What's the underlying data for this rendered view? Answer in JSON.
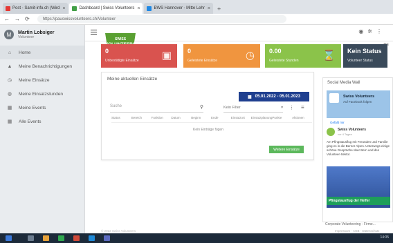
{
  "browser": {
    "tabs": [
      {
        "label": "Post - Samit-info.ch (Wird",
        "active": false
      },
      {
        "label": "Dashboard | Swiss Volunteers",
        "active": true
      },
      {
        "label": "BWS Hannover - Mitte Lehr",
        "active": false
      }
    ],
    "new_tab": "+",
    "nav": {
      "back": "←",
      "forward": "→",
      "reload": "⟳"
    },
    "url": "https://pauswissvolunteers.ch/Volunteer"
  },
  "sidebar": {
    "user": {
      "initial": "M",
      "name": "Martin Lobsiger",
      "role": "Volunteer"
    },
    "items": [
      {
        "label": "Home",
        "icon": "home-icon",
        "glyph": "⌂",
        "active": true
      },
      {
        "label": "Meine Benachrichtigungen",
        "icon": "bell-icon",
        "glyph": "🔔",
        "active": false
      },
      {
        "label": "Meine Einsätze",
        "icon": "clock-icon",
        "glyph": "◷",
        "active": false
      },
      {
        "label": "Meine Einsatzstunden",
        "icon": "gauge-icon",
        "glyph": "◍",
        "active": false
      },
      {
        "label": "Meine Events",
        "icon": "calendar-icon",
        "glyph": "▦",
        "active": false
      },
      {
        "label": "Alle Events",
        "icon": "calendar-icon",
        "glyph": "▦",
        "active": false
      }
    ]
  },
  "header": {
    "lang": "DE"
  },
  "logo": {
    "text1": "SWISS",
    "text2": "VOLUNTEERS"
  },
  "tiles": [
    {
      "value": "0",
      "label": "Unbestätigte Einsätze",
      "icon": "clipboard-icon",
      "glyph": "▣",
      "color": "#d9534f"
    },
    {
      "value": "0",
      "label": "Geleistete Einsätze",
      "icon": "clock-icon",
      "glyph": "◷",
      "color": "#f0953f"
    },
    {
      "value": "0.00",
      "label": "Geleistete Stunden",
      "icon": "hourglass-icon",
      "glyph": "⌛",
      "color": "#8bc34a"
    },
    {
      "value": "Kein Status",
      "label": "Volunteer Status",
      "icon": "",
      "glyph": "",
      "color": "#3a4a5a"
    }
  ],
  "assignments": {
    "title": "Meine aktuellen Einsätze",
    "date_range": "05.01.2022 - 05.01.2023",
    "search_placeholder": "Suche",
    "filter_label": "Kein Filter",
    "columns": [
      "Status",
      "Bereich",
      "Funktion",
      "Datum",
      "Beginn",
      "Ende",
      "Einsatzort",
      "Einsatzplanung",
      "Punkte",
      "Aktionen"
    ],
    "empty_text": "Kein Einträge fügen",
    "more_button": "Weitere Einsätze"
  },
  "social": {
    "title": "Social Media Wall",
    "feature_title": "Swiss Volunteers",
    "feature_sub": "Auf Facebook folgen",
    "follow": "Gefällt mir",
    "post_name": "Swiss Volunteers",
    "post_date": "vor 4 Tagen",
    "post_text": "Am Pfingstausflug mit Freunden und Familie ging es in die Berner Alpen. Unterwegs einige schöne Gespräche über Bern und den Volunteer-Sektor.",
    "post_banner": "Pfingstausflug der Helfer",
    "corporate": "Corporate Volunteering - Firme..."
  },
  "footer": {
    "copyright": "© 2022 Swiss Volunteers",
    "links": "Impressum · AGB · Datenschutz"
  },
  "taskbar": {
    "time": "14:05"
  }
}
